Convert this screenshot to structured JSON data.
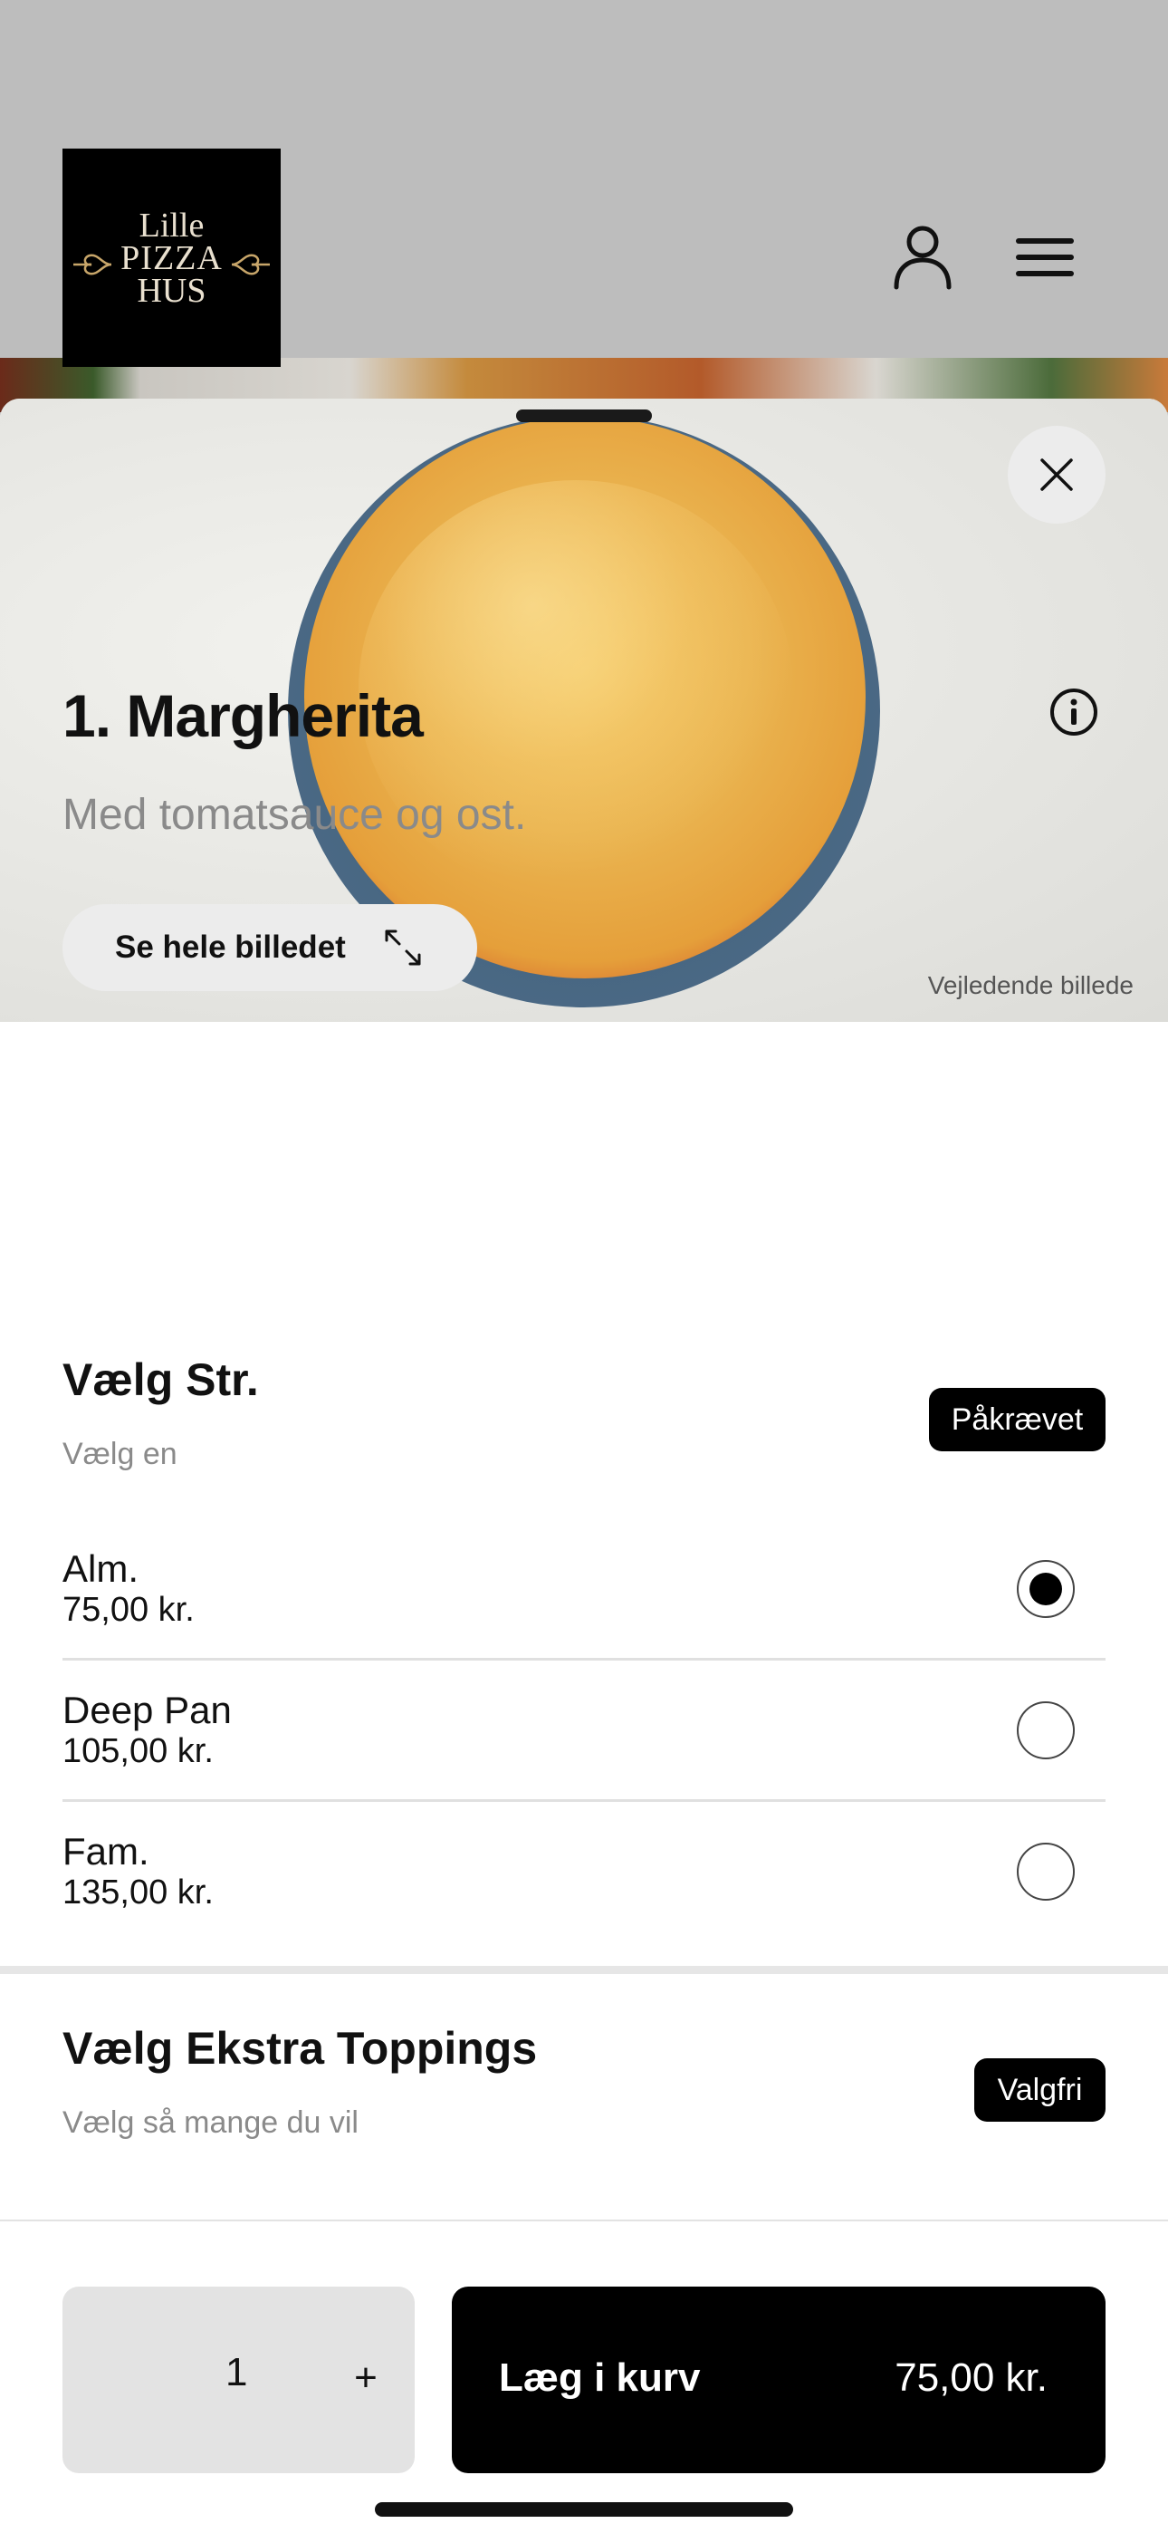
{
  "header": {
    "logo": {
      "line1": "Lille",
      "line2": "PIZZA",
      "line3": "HUS"
    },
    "icons": {
      "account": "user-icon",
      "menu": "hamburger-menu-icon"
    }
  },
  "hero": {
    "see_full_image_label": "Se hele billedet",
    "caption": "Vejledende billede",
    "icons": {
      "close": "close-icon",
      "expand": "expand-icon"
    }
  },
  "product": {
    "title": "1. Margherita",
    "description": "Med tomatsauce og ost."
  },
  "size_section": {
    "title": "Vælg Str.",
    "subtitle": "Vælg en",
    "badge": "Påkrævet",
    "options": [
      {
        "name": "Alm.",
        "price": "75,00 kr.",
        "selected": true
      },
      {
        "name": "Deep Pan",
        "price": "105,00 kr.",
        "selected": false
      },
      {
        "name": "Fam.",
        "price": "135,00 kr.",
        "selected": false
      }
    ]
  },
  "toppings_section": {
    "title": "Vælg Ekstra Toppings",
    "subtitle": "Vælg så mange du vil",
    "badge": "Valgfri"
  },
  "bottom": {
    "quantity": "1",
    "plus": "+",
    "add_label": "Læg i kurv",
    "add_price": "75,00 kr."
  }
}
